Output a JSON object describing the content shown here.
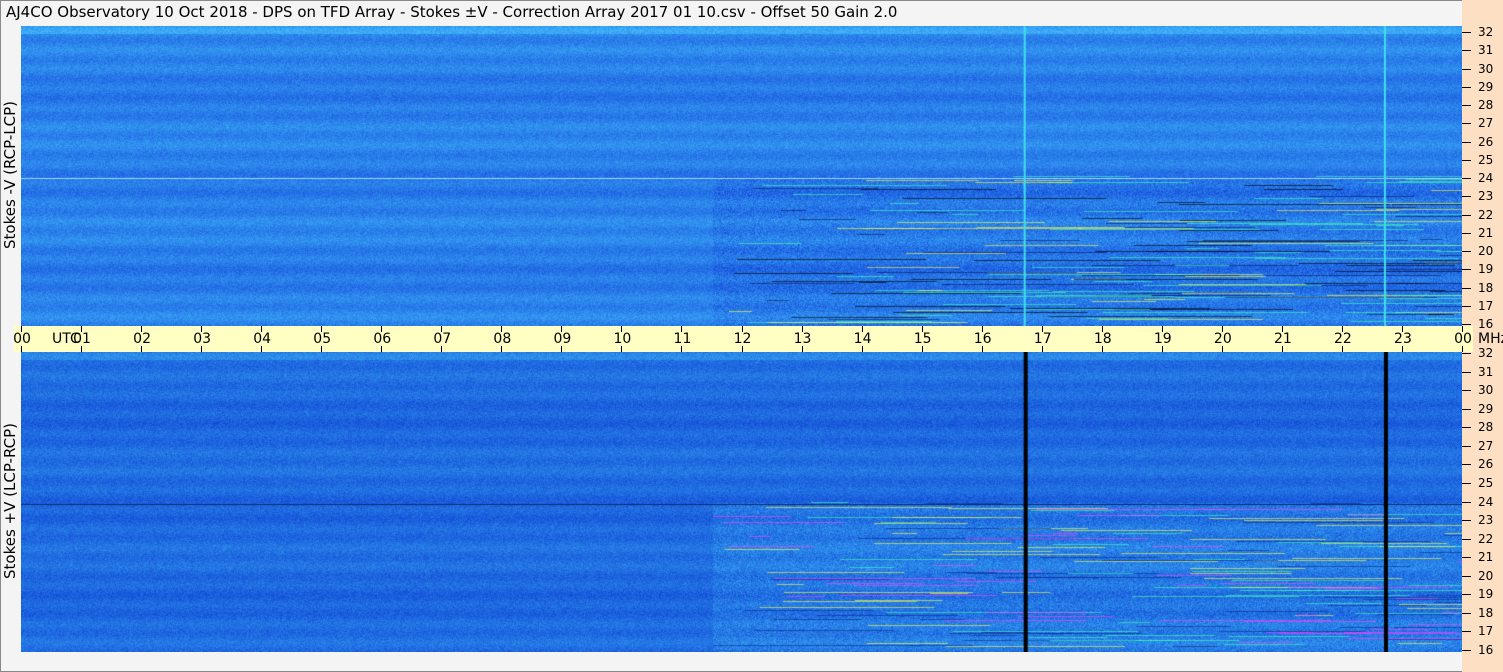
{
  "title": "AJ4CO Observatory  10 Oct 2018  -  DPS on TFD Array  -  Stokes ±V  -  Correction Array 2017 01 10.csv  -  Offset 50  Gain 2.0",
  "chart_data": [
    {
      "type": "heatmap",
      "ylabel": "Stokes -V (RCP-LCP)",
      "x_unit": "UTC",
      "y_unit": "MHz",
      "xlim": [
        0,
        24
      ],
      "ylim": [
        16,
        32
      ],
      "x_ticks": [
        "00",
        "01",
        "02",
        "03",
        "04",
        "05",
        "06",
        "07",
        "08",
        "09",
        "10",
        "11",
        "12",
        "13",
        "14",
        "15",
        "16",
        "17",
        "18",
        "19",
        "20",
        "21",
        "22",
        "23",
        "00"
      ],
      "y_ticks": [
        "16",
        "17",
        "18",
        "19",
        "20",
        "21",
        "22",
        "23",
        "24",
        "25",
        "26",
        "27",
        "28",
        "29",
        "30",
        "31",
        "32"
      ],
      "colormap_base": "#2a80ea",
      "vertical_lines_utc": [
        16.7,
        22.7
      ],
      "vertical_line_color": "#40e0e8",
      "horizontal_line_mhz": 24,
      "horizontal_line_color": "#9fd8ff"
    },
    {
      "type": "heatmap",
      "ylabel": "Stokes +V (LCP-RCP)",
      "x_unit": "UTC",
      "y_unit": "MHz",
      "xlim": [
        0,
        24
      ],
      "ylim": [
        16,
        32
      ],
      "x_ticks": [
        "00",
        "01",
        "02",
        "03",
        "04",
        "05",
        "06",
        "07",
        "08",
        "09",
        "10",
        "11",
        "12",
        "13",
        "14",
        "15",
        "16",
        "17",
        "18",
        "19",
        "20",
        "21",
        "22",
        "23",
        "00"
      ],
      "y_ticks": [
        "16",
        "17",
        "18",
        "19",
        "20",
        "21",
        "22",
        "23",
        "24",
        "25",
        "26",
        "27",
        "28",
        "29",
        "30",
        "31",
        "32"
      ],
      "colormap_base": "#1f6ae0",
      "vertical_lines_utc": [
        16.7,
        22.7
      ],
      "vertical_line_color": "#000000",
      "horizontal_line_mhz": 24,
      "horizontal_line_color": "#0a2a70"
    }
  ],
  "axis": {
    "utc_label": "UTC",
    "mhz_label": "MHz"
  }
}
